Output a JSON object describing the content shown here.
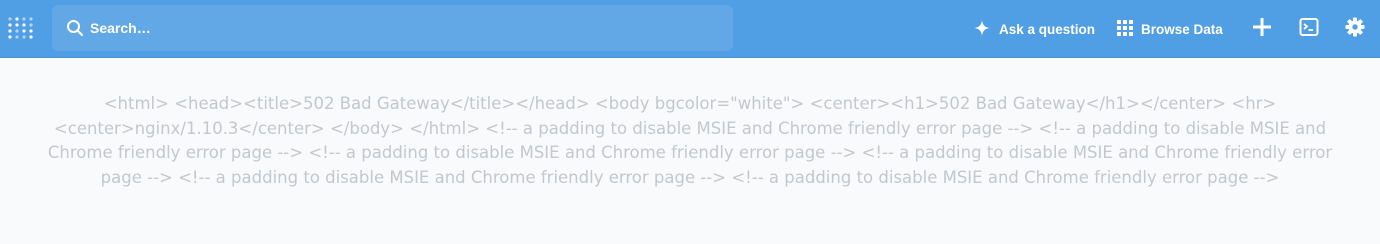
{
  "navbar": {
    "logo": "metabase-logo-icon",
    "search": {
      "placeholder": "Search…",
      "icon": "search-icon"
    },
    "ask_label": "Ask a question",
    "browse_label": "Browse Data",
    "icons": [
      "sparkle-icon",
      "grid-icon",
      "plus-icon",
      "sql-editor-icon",
      "gear-icon"
    ],
    "colors": {
      "bar": "#509EE3",
      "search_bg": "#63A8E6",
      "text": "#FFFFFF"
    }
  },
  "main": {
    "error_message": "<html> <head><title>502 Bad Gateway</title></head> <body bgcolor=\"white\"> <center><h1>502 Bad Gateway</h1></center> <hr> <center>nginx/1.10.3</center> </body> </html> <!-- a padding to disable MSIE and Chrome friendly error page --> <!-- a padding to disable MSIE and Chrome friendly error page --> <!-- a padding to disable MSIE and Chrome friendly error page --> <!-- a padding to disable MSIE and Chrome friendly error page --> <!-- a padding to disable MSIE and Chrome friendly error page --> <!-- a padding to disable MSIE and Chrome friendly error page -->",
    "text_color": "#C2C8CE",
    "background": "#F9FAFB"
  }
}
